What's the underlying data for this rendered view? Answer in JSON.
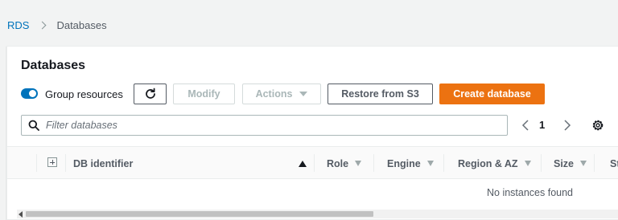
{
  "breadcrumb": {
    "root": "RDS",
    "current": "Databases"
  },
  "panel": {
    "title": "Databases"
  },
  "toolbar": {
    "group_resources_label": "Group resources",
    "group_resources_on": true,
    "modify_label": "Modify",
    "actions_label": "Actions",
    "restore_label": "Restore from S3",
    "create_label": "Create database"
  },
  "search": {
    "placeholder": "Filter databases",
    "value": ""
  },
  "pagination": {
    "current_page": "1"
  },
  "table": {
    "columns": [
      "DB identifier",
      "Role",
      "Engine",
      "Region & AZ",
      "Size",
      "St"
    ],
    "empty_text": "No instances found"
  },
  "colors": {
    "accent": "#0073bb",
    "primary_button": "#ec7211"
  }
}
